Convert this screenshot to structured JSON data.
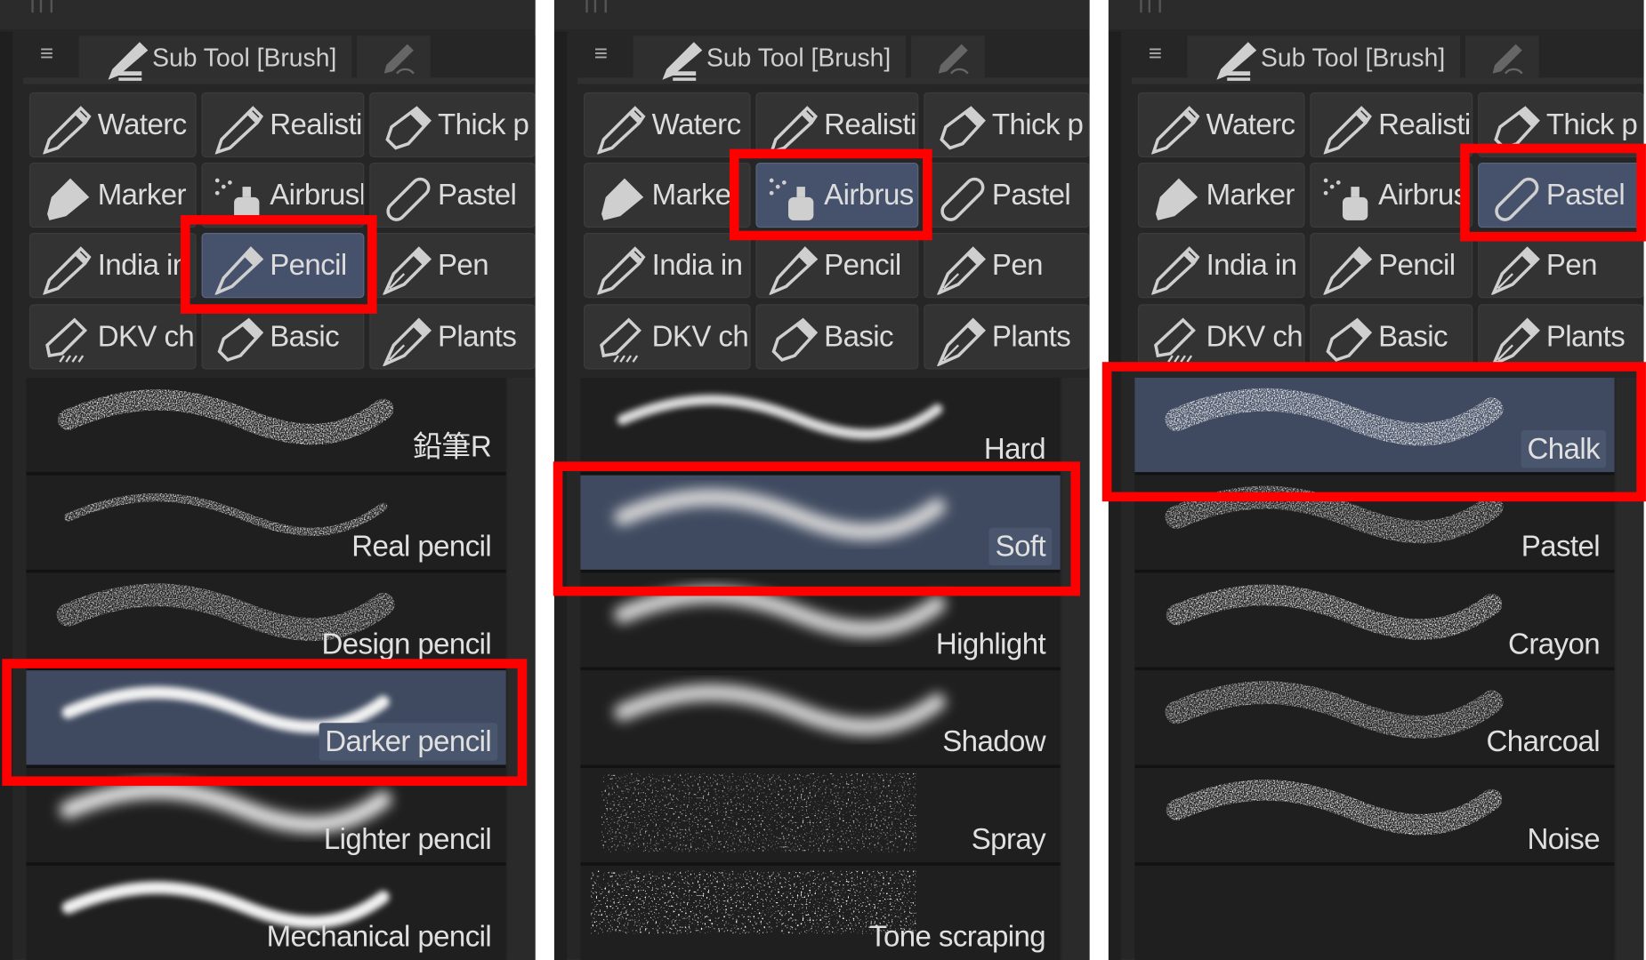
{
  "colors": {
    "panel_bg": "#262626",
    "cell_bg": "#333333",
    "selected_bg": "#46526c",
    "highlight": "#ff0000",
    "text": "#dcdcdc"
  },
  "panels": [
    {
      "tab_title": "Sub Tool [Brush]",
      "grid": [
        {
          "label": "Waterc",
          "icon": "brush-tip-icon",
          "selected": false
        },
        {
          "label": "Realisti",
          "icon": "brush-tip-icon",
          "selected": false
        },
        {
          "label": "Thick p",
          "icon": "paint-tube-icon",
          "selected": false
        },
        {
          "label": "Marker",
          "icon": "marker-icon",
          "selected": false
        },
        {
          "label": "Airbrush",
          "icon": "airbrush-icon",
          "selected": false
        },
        {
          "label": "Pastel",
          "icon": "pastel-icon",
          "selected": false
        },
        {
          "label": "India in",
          "icon": "brush-tip-icon",
          "selected": false
        },
        {
          "label": "Pencil",
          "icon": "pencil-icon",
          "selected": true
        },
        {
          "label": "Pen",
          "icon": "pen-nib-icon",
          "selected": false
        },
        {
          "label": "DKV ch",
          "icon": "dkv-brush-icon",
          "selected": false
        },
        {
          "label": "Basic",
          "icon": "paint-tube-icon",
          "selected": false
        },
        {
          "label": "Plants",
          "icon": "pen-nib-icon",
          "selected": false
        }
      ],
      "list": [
        {
          "label": "鉛筆R",
          "stroke": "grainy",
          "selected": false
        },
        {
          "label": "Real pencil",
          "stroke": "thin-grainy",
          "selected": false
        },
        {
          "label": "Design pencil",
          "stroke": "grainy-soft",
          "selected": false
        },
        {
          "label": "Darker pencil",
          "stroke": "solid",
          "selected": true
        },
        {
          "label": "Lighter pencil",
          "stroke": "soft-solid",
          "selected": false
        },
        {
          "label": "Mechanical pencil",
          "stroke": "solid",
          "selected": false
        }
      ],
      "highlights": [
        "grid",
        "list"
      ]
    },
    {
      "tab_title": "Sub Tool [Brush]",
      "grid": [
        {
          "label": "Waterc",
          "icon": "brush-tip-icon",
          "selected": false
        },
        {
          "label": "Realisti",
          "icon": "brush-tip-icon",
          "selected": false
        },
        {
          "label": "Thick p",
          "icon": "paint-tube-icon",
          "selected": false
        },
        {
          "label": "Marke",
          "icon": "marker-icon",
          "selected": false
        },
        {
          "label": "Airbrus",
          "icon": "airbrush-icon",
          "selected": true
        },
        {
          "label": "Pastel",
          "icon": "pastel-icon",
          "selected": false
        },
        {
          "label": "India in",
          "icon": "brush-tip-icon",
          "selected": false
        },
        {
          "label": "Pencil",
          "icon": "pencil-icon",
          "selected": false
        },
        {
          "label": "Pen",
          "icon": "pen-nib-icon",
          "selected": false
        },
        {
          "label": "DKV ch",
          "icon": "dkv-brush-icon",
          "selected": false
        },
        {
          "label": "Basic",
          "icon": "paint-tube-icon",
          "selected": false
        },
        {
          "label": "Plants",
          "icon": "pen-nib-icon",
          "selected": false
        }
      ],
      "list": [
        {
          "label": "Hard",
          "stroke": "hard-air",
          "selected": false
        },
        {
          "label": "Soft",
          "stroke": "soft-air",
          "selected": true
        },
        {
          "label": "Highlight",
          "stroke": "soft-air",
          "selected": false
        },
        {
          "label": "Shadow",
          "stroke": "soft-air",
          "selected": false
        },
        {
          "label": "Spray",
          "stroke": "spray",
          "selected": false
        },
        {
          "label": "Tone scraping",
          "stroke": "tone",
          "selected": false
        }
      ]
    },
    {
      "tab_title": "Sub Tool [Brush]",
      "grid": [
        {
          "label": "Waterc",
          "icon": "brush-tip-icon",
          "selected": false
        },
        {
          "label": "Realisti",
          "icon": "brush-tip-icon",
          "selected": false
        },
        {
          "label": "Thick p",
          "icon": "paint-tube-icon",
          "selected": false
        },
        {
          "label": "Marker",
          "icon": "marker-icon",
          "selected": false
        },
        {
          "label": "Airbrus",
          "icon": "airbrush-icon",
          "selected": false
        },
        {
          "label": "Pastel",
          "icon": "pastel-icon",
          "selected": true
        },
        {
          "label": "India in",
          "icon": "brush-tip-icon",
          "selected": false
        },
        {
          "label": "Pencil",
          "icon": "pencil-icon",
          "selected": false
        },
        {
          "label": "Pen",
          "icon": "pen-nib-icon",
          "selected": false
        },
        {
          "label": "DKV ch",
          "icon": "dkv-brush-icon",
          "selected": false
        },
        {
          "label": "Basic",
          "icon": "paint-tube-icon",
          "selected": false
        },
        {
          "label": "Plants",
          "icon": "pen-nib-icon",
          "selected": false
        }
      ],
      "list": [
        {
          "label": "Chalk",
          "stroke": "chalk",
          "selected": true
        },
        {
          "label": "Pastel",
          "stroke": "grainy-soft",
          "selected": false
        },
        {
          "label": "Crayon",
          "stroke": "grainy",
          "selected": false
        },
        {
          "label": "Charcoal",
          "stroke": "grainy-soft",
          "selected": false
        },
        {
          "label": "Noise",
          "stroke": "grainy",
          "selected": false
        },
        {
          "label": "",
          "stroke": "none",
          "selected": false
        }
      ]
    }
  ]
}
